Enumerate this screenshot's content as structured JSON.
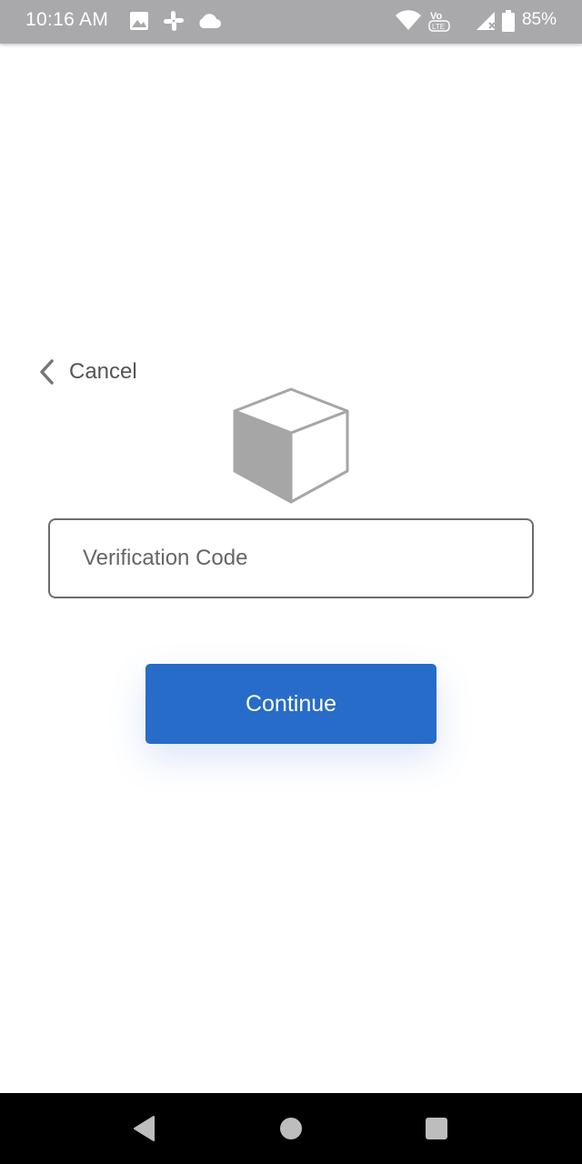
{
  "status_bar": {
    "time": "10:16 AM",
    "battery_percent": "85%",
    "icons": [
      "image-icon",
      "slack-icon",
      "cloud-icon",
      "wifi-icon",
      "volte-icon",
      "signal-icon",
      "battery-icon"
    ],
    "volte_text": "Vo LTE"
  },
  "nav": {
    "cancel_label": "Cancel"
  },
  "form": {
    "code_placeholder": "Verification Code",
    "code_value": "",
    "continue_label": "Continue"
  },
  "colors": {
    "status_bar": "#a9a8ab",
    "primary_button": "#276cc8",
    "cube_grey": "#a6a6a6"
  },
  "system_nav": {
    "buttons": [
      "back-icon",
      "home-icon",
      "recents-icon"
    ]
  }
}
